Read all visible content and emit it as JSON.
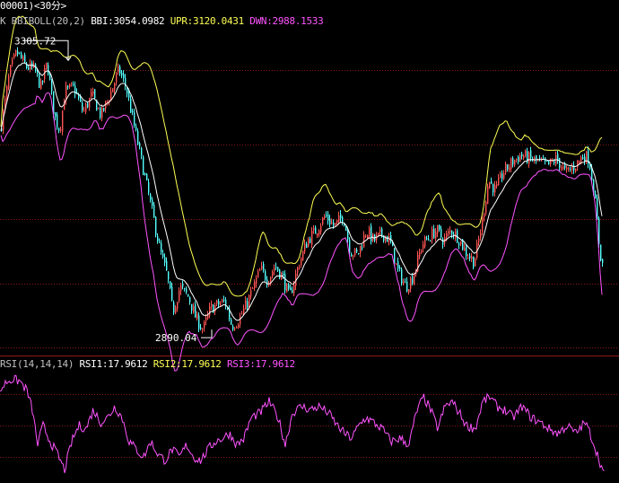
{
  "window": {
    "title": "00001)<30分>"
  },
  "legend": {
    "main": {
      "prefix": "K",
      "name": "BBIBOLL(20,2)",
      "bbi_label": "BBI:3054.0982",
      "upr_label": "UPR:3120.0431",
      "dwn_label": "DWN:2988.1533"
    },
    "rsi": {
      "name": "RSI(14,14,14)",
      "rsi1_label": "RSI1:17.9612",
      "rsi2_label": "RSI2:17.9612",
      "rsi3_label": "RSI3:17.9612"
    }
  },
  "colors": {
    "background": "#000000",
    "grid": "#8b1a1a",
    "up_candle": "#ff5454",
    "down_candle": "#54ffff",
    "bbi": "#ffffff",
    "upr": "#ffff54",
    "dwn": "#ff54ff",
    "rsi": "#ff54ff",
    "divider": "#c0c0c0"
  },
  "chart_data": [
    {
      "type": "line",
      "subtype": "candlestick",
      "indicator": "BBIBOLL(20,2)",
      "price_range": [
        2865,
        3325
      ],
      "gridlines": [
        3265,
        3160,
        3055,
        2965,
        2875
      ],
      "annotations": {
        "high": {
          "value": 3305.72,
          "text": "3305.72"
        },
        "low": {
          "value": 2890.04,
          "text": "2890.04"
        }
      },
      "close_anchors": [
        [
          0,
          3180
        ],
        [
          10,
          3260
        ],
        [
          18,
          3290
        ],
        [
          28,
          3270
        ],
        [
          38,
          3265
        ],
        [
          45,
          3240
        ],
        [
          52,
          3275
        ],
        [
          60,
          3200
        ],
        [
          66,
          3180
        ],
        [
          72,
          3235
        ],
        [
          82,
          3240
        ],
        [
          92,
          3205
        ],
        [
          102,
          3230
        ],
        [
          112,
          3200
        ],
        [
          122,
          3230
        ],
        [
          132,
          3265
        ],
        [
          140,
          3240
        ],
        [
          150,
          3180
        ],
        [
          160,
          3120
        ],
        [
          170,
          3060
        ],
        [
          178,
          3010
        ],
        [
          186,
          2975
        ],
        [
          192,
          2925
        ],
        [
          200,
          2960
        ],
        [
          210,
          2945
        ],
        [
          218,
          2915
        ],
        [
          226,
          2900
        ],
        [
          234,
          2930
        ],
        [
          242,
          2935
        ],
        [
          250,
          2940
        ],
        [
          258,
          2905
        ],
        [
          266,
          2915
        ],
        [
          274,
          2935
        ],
        [
          282,
          2960
        ],
        [
          290,
          2985
        ],
        [
          298,
          2970
        ],
        [
          306,
          2990
        ],
        [
          314,
          2975
        ],
        [
          322,
          2945
        ],
        [
          332,
          2990
        ],
        [
          342,
          3025
        ],
        [
          352,
          3040
        ],
        [
          362,
          3060
        ],
        [
          372,
          3045
        ],
        [
          382,
          3060
        ],
        [
          390,
          3010
        ],
        [
          398,
          3005
        ],
        [
          408,
          3040
        ],
        [
          416,
          3025
        ],
        [
          426,
          3035
        ],
        [
          434,
          3025
        ],
        [
          442,
          2985
        ],
        [
          452,
          2960
        ],
        [
          460,
          2975
        ],
        [
          470,
          3020
        ],
        [
          478,
          3030
        ],
        [
          486,
          3040
        ],
        [
          494,
          3025
        ],
        [
          502,
          3040
        ],
        [
          510,
          3030
        ],
        [
          518,
          3010
        ],
        [
          528,
          2995
        ],
        [
          536,
          3045
        ],
        [
          544,
          3110
        ],
        [
          552,
          3095
        ],
        [
          560,
          3120
        ],
        [
          570,
          3135
        ],
        [
          580,
          3145
        ],
        [
          590,
          3140
        ],
        [
          600,
          3135
        ],
        [
          610,
          3130
        ],
        [
          620,
          3140
        ],
        [
          630,
          3120
        ],
        [
          640,
          3130
        ],
        [
          650,
          3145
        ],
        [
          656,
          3140
        ],
        [
          662,
          3090
        ],
        [
          668,
          3010
        ],
        [
          672,
          2985
        ]
      ],
      "last": {
        "bbi": 3054.0982,
        "upr": 3120.0431,
        "dwn": 2988.1533
      }
    },
    {
      "type": "line",
      "indicator": "RSI(14,14,14)",
      "value_range": [
        15,
        85
      ],
      "gridlines": [
        70,
        50,
        30
      ],
      "anchors": [
        [
          0,
          72
        ],
        [
          8,
          78
        ],
        [
          14,
          79
        ],
        [
          22,
          78
        ],
        [
          30,
          72
        ],
        [
          36,
          60
        ],
        [
          42,
          38
        ],
        [
          48,
          50
        ],
        [
          56,
          40
        ],
        [
          64,
          32
        ],
        [
          72,
          22
        ],
        [
          80,
          40
        ],
        [
          88,
          50
        ],
        [
          96,
          48
        ],
        [
          104,
          60
        ],
        [
          112,
          52
        ],
        [
          120,
          55
        ],
        [
          128,
          62
        ],
        [
          136,
          55
        ],
        [
          144,
          40
        ],
        [
          152,
          35
        ],
        [
          160,
          30
        ],
        [
          168,
          40
        ],
        [
          176,
          32
        ],
        [
          184,
          28
        ],
        [
          192,
          35
        ],
        [
          200,
          30
        ],
        [
          208,
          38
        ],
        [
          216,
          30
        ],
        [
          224,
          28
        ],
        [
          232,
          35
        ],
        [
          240,
          40
        ],
        [
          248,
          42
        ],
        [
          256,
          45
        ],
        [
          264,
          38
        ],
        [
          272,
          42
        ],
        [
          280,
          55
        ],
        [
          290,
          58
        ],
        [
          300,
          65
        ],
        [
          310,
          55
        ],
        [
          318,
          38
        ],
        [
          326,
          58
        ],
        [
          336,
          62
        ],
        [
          346,
          60
        ],
        [
          356,
          62
        ],
        [
          366,
          58
        ],
        [
          376,
          50
        ],
        [
          384,
          45
        ],
        [
          392,
          42
        ],
        [
          400,
          50
        ],
        [
          408,
          55
        ],
        [
          416,
          52
        ],
        [
          426,
          48
        ],
        [
          436,
          40
        ],
        [
          446,
          42
        ],
        [
          456,
          38
        ],
        [
          464,
          58
        ],
        [
          472,
          68
        ],
        [
          480,
          60
        ],
        [
          488,
          48
        ],
        [
          496,
          62
        ],
        [
          504,
          65
        ],
        [
          512,
          58
        ],
        [
          520,
          50
        ],
        [
          530,
          48
        ],
        [
          538,
          65
        ],
        [
          546,
          68
        ],
        [
          554,
          62
        ],
        [
          562,
          60
        ],
        [
          572,
          55
        ],
        [
          582,
          62
        ],
        [
          592,
          55
        ],
        [
          602,
          52
        ],
        [
          612,
          48
        ],
        [
          622,
          45
        ],
        [
          632,
          50
        ],
        [
          642,
          45
        ],
        [
          652,
          52
        ],
        [
          658,
          45
        ],
        [
          664,
          35
        ],
        [
          670,
          25
        ],
        [
          674,
          18
        ]
      ],
      "last": 17.9612
    }
  ]
}
